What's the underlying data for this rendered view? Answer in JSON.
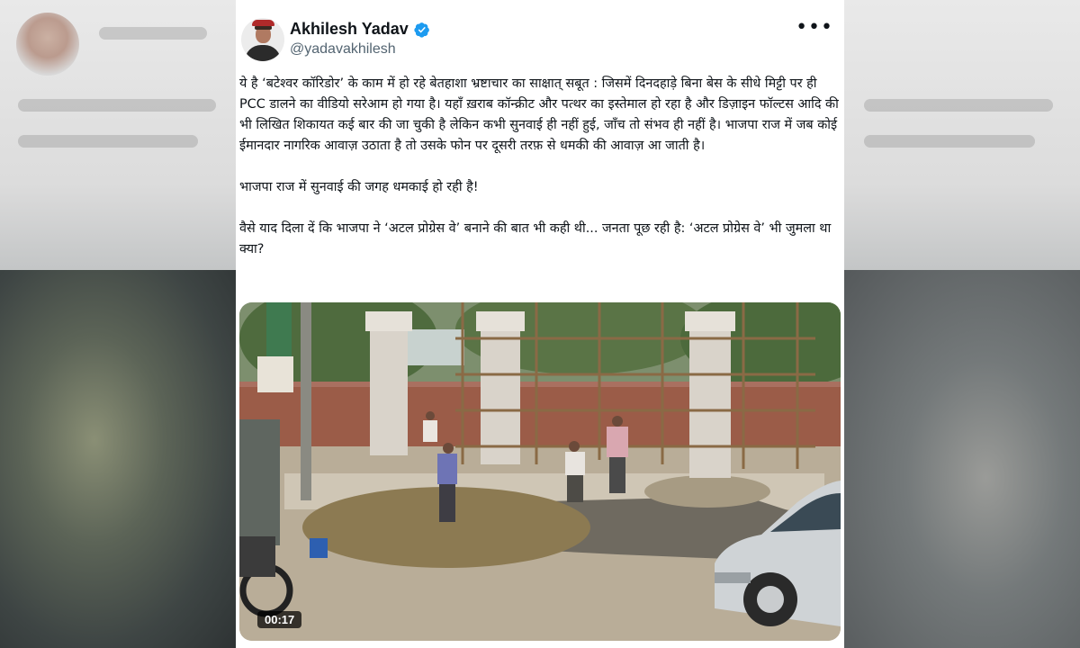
{
  "tweet": {
    "author": {
      "display_name": "Akhilesh Yadav",
      "handle": "@yadavakhilesh",
      "verified": true,
      "verified_color": "#1d9bf0"
    },
    "more_icon": "more-horizontal-icon",
    "paragraphs": [
      "ये है ‘बटेश्वर कॉरिडोर’ के काम में हो रहे बेतहाशा भ्रष्टाचार का साक्षात् सबूत : जिसमें दिनदहाड़े बिना बेस के सीधे मिट्टी पर ही PCC डालने का वीडियो सरेआम हो गया है। यहाँ ख़राब कॉन्क्रीट और पत्थर का इस्तेमाल हो रहा है और डिज़ाइन फॉल्टस आदि की भी लिखित शिकायत कई बार की जा चुकी है लेकिन कभी सुनवाई ही नहीं हुई, जाँच तो संभव ही नहीं है। भाजपा राज में जब कोई ईमानदार नागरिक आवाज़ उठाता है तो उसके फोन पर दूसरी तरफ़ से धमकी की आवाज़ आ जाती है।",
      "भाजपा राज में सुनवाई की जगह धमकाई हो रही है!",
      "वैसे याद दिला दें कि भाजपा ने ‘अटल प्रोग्रेस वे’ बनाने की बात भी कही थी... जनता पूछ रही है: ‘अटल प्रोग्रेस वे’ भी जुमला था क्या?"
    ],
    "video": {
      "duration": "00:17"
    }
  }
}
